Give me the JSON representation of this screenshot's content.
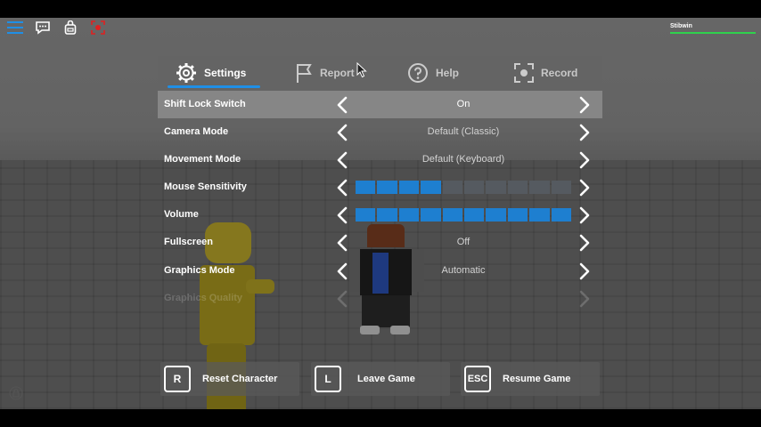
{
  "topbar": {
    "player_name": "Stibwin",
    "icons": [
      "hamburger-menu-icon",
      "chat-icon",
      "backpack-icon",
      "record-icon"
    ]
  },
  "tabs": [
    {
      "label": "Settings",
      "icon": "gear-icon",
      "active": true
    },
    {
      "label": "Report",
      "icon": "flag-icon",
      "active": false
    },
    {
      "label": "Help",
      "icon": "question-icon",
      "active": false
    },
    {
      "label": "Record",
      "icon": "record-icon",
      "active": false
    }
  ],
  "settings": [
    {
      "label": "Shift Lock Switch",
      "value": "On",
      "highlighted": true
    },
    {
      "label": "Camera Mode",
      "value": "Default (Classic)"
    },
    {
      "label": "Movement Mode",
      "value": "Default (Keyboard)"
    },
    {
      "label": "Mouse Sensitivity",
      "slider_level": 4,
      "slider_max": 10
    },
    {
      "label": "Volume",
      "slider_level": 10,
      "slider_max": 10
    },
    {
      "label": "Fullscreen",
      "value": "Off"
    },
    {
      "label": "Graphics Mode",
      "value": "Automatic"
    },
    {
      "label": "Graphics Quality",
      "faded": true
    }
  ],
  "buttons": [
    {
      "key": "R",
      "label": "Reset Character"
    },
    {
      "key": "L",
      "label": "Leave Game"
    },
    {
      "key": "ESC",
      "label": "Resume Game"
    }
  ],
  "colors": {
    "accent": "#1f8fe6",
    "slider_on": "#1e7fd0",
    "slider_off": "#555a60",
    "health": "#2fd14d",
    "record_red": "#e02020"
  }
}
